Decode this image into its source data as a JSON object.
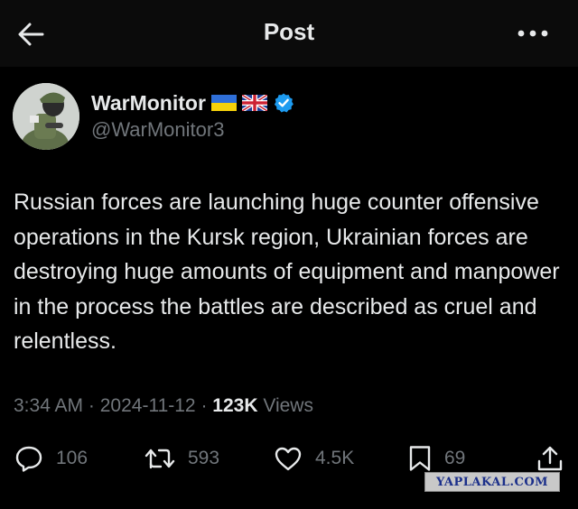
{
  "header": {
    "title": "Post",
    "back_icon": "arrow-left-icon",
    "more_icon": "more-horizontal-icon"
  },
  "author": {
    "display_name": "WarMonitor",
    "handle": "@WarMonitor3",
    "flags": [
      "ukraine-flag-icon",
      "uk-flag-icon"
    ],
    "verified_icon": "verified-badge-icon",
    "verified_color": "#1d9bf0"
  },
  "post": {
    "text": "Russian forces are launching huge counter offensive operations in the Kursk region, Ukrainian forces are destroying huge amounts of equipment and manpower in the process the battles are described as cruel and relentless.",
    "time": "3:34 AM",
    "date": "2024-11-12",
    "views_count": "123K",
    "views_label": "Views"
  },
  "actions": {
    "replies": "106",
    "reposts": "593",
    "likes": "4.5K",
    "bookmarks": "69"
  },
  "watermark": "YAPLAKAL.COM",
  "colors": {
    "background": "#000000",
    "header_bg": "#0b0b0b",
    "text": "#e7e9ea",
    "muted": "#71767b"
  }
}
